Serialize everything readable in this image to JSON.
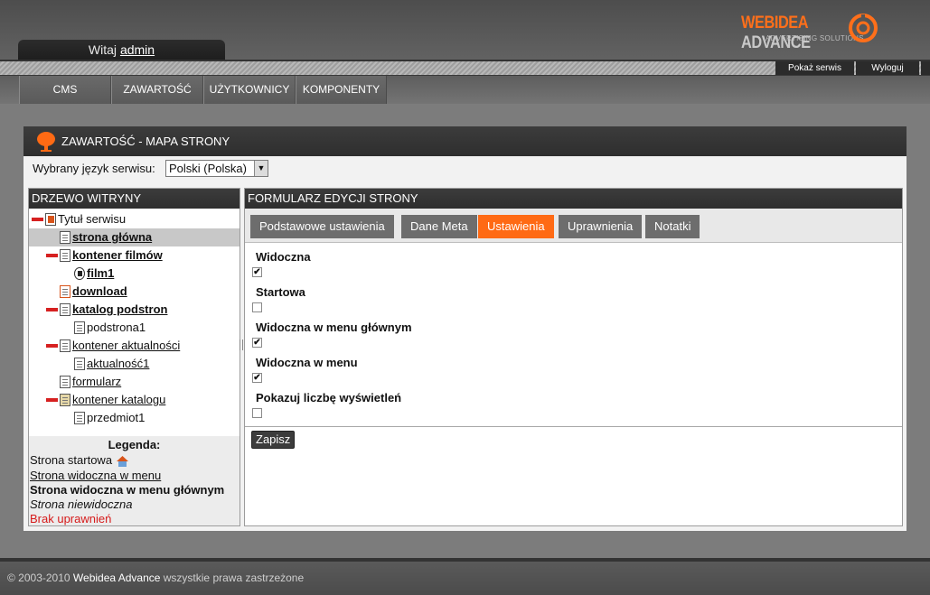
{
  "header": {
    "welcome": "Witaj",
    "user": "admin",
    "logo_brand": "WEBIDEA",
    "logo_product": "ADVANCE",
    "logo_tagline": "ADVERTISING SOLUTIONS",
    "show_site": "Pokaż serwis",
    "logout": "Wyloguj"
  },
  "nav": {
    "items": [
      "CMS",
      "ZAWARTOŚĆ",
      "UŻYTKOWNICY",
      "KOMPONENTY"
    ]
  },
  "page": {
    "title": "ZAWARTOŚĆ - MAPA STRONY",
    "lang_label": "Wybrany język serwisu:",
    "lang_value": "Polski (Polska)"
  },
  "tree": {
    "title": "DRZEWO WITRYNY",
    "items": [
      "Tytuł serwisu",
      "strona główna",
      "kontener filmów",
      "film1",
      "download",
      "katalog podstron",
      "podstrona1",
      "kontener aktualności",
      "aktualność1",
      "formularz",
      "kontener katalogu",
      "przedmiot1"
    ]
  },
  "legend": {
    "title": "Legenda:",
    "start": "Strona startowa",
    "menu": "Strona widoczna w menu",
    "main_menu": "Strona widoczna w menu głównym",
    "hidden": "Strona niewidoczna",
    "no_rights": "Brak uprawnień"
  },
  "form": {
    "title": "FORMULARZ EDYCJI STRONY",
    "tabs": [
      "Podstawowe ustawienia",
      "Dane Meta",
      "Ustawienia",
      "Uprawnienia",
      "Notatki"
    ],
    "active_tab": "Ustawienia",
    "fields": [
      {
        "label": "Widoczna",
        "checked": true
      },
      {
        "label": "Startowa",
        "checked": false
      },
      {
        "label": "Widoczna w menu głównym",
        "checked": true
      },
      {
        "label": "Widoczna w menu",
        "checked": true
      },
      {
        "label": "Pokazuj liczbę wyświetleń",
        "checked": false
      }
    ],
    "check_mark": "✔",
    "save": "Zapisz"
  },
  "footer": {
    "copyright": "© 2003-2010",
    "brand": "Webidea Advance",
    "rights": "wszystkie prawa zastrzeżone"
  },
  "colors": {
    "accent": "#ff6a14",
    "tab": "#6d6d6d",
    "dark_bar": "#333333",
    "no_rights": "#d61a1a"
  }
}
